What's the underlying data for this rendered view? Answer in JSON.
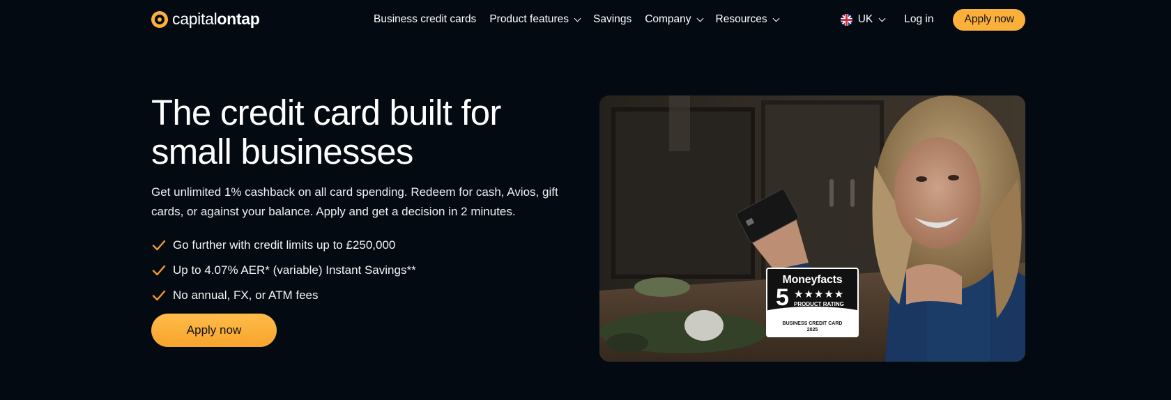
{
  "brand": {
    "name_regular": "capital",
    "name_bold": "ontap"
  },
  "nav": {
    "items": [
      {
        "label": "Business credit cards",
        "dropdown": false
      },
      {
        "label": "Product features",
        "dropdown": true
      },
      {
        "label": "Savings",
        "dropdown": false
      },
      {
        "label": "Company",
        "dropdown": true
      },
      {
        "label": "Resources",
        "dropdown": true
      }
    ],
    "locale": "UK",
    "login": "Log in",
    "cta": "Apply now"
  },
  "hero": {
    "title": "The credit card built for small businesses",
    "subtitle": "Get unlimited 1% cashback on all card spending. Redeem for cash, Avios, gift cards, or against your balance. Apply and get a decision in 2 minutes.",
    "features": [
      "Go further with credit limits up to £250,000",
      "Up to 4.07% AER* (variable) Instant Savings**",
      "No annual, FX, or ATM fees"
    ],
    "cta": "Apply now"
  },
  "badge": {
    "brand": "Moneyfacts",
    "rating_number": "5",
    "stars": "★★★★★",
    "rating_label": "PRODUCT RATING",
    "category_line1": "BUSINESS CREDIT CARD",
    "category_line2": "2025"
  },
  "colors": {
    "accent": "#fbb03b",
    "background": "#030a11",
    "check": "#f39a2a"
  }
}
